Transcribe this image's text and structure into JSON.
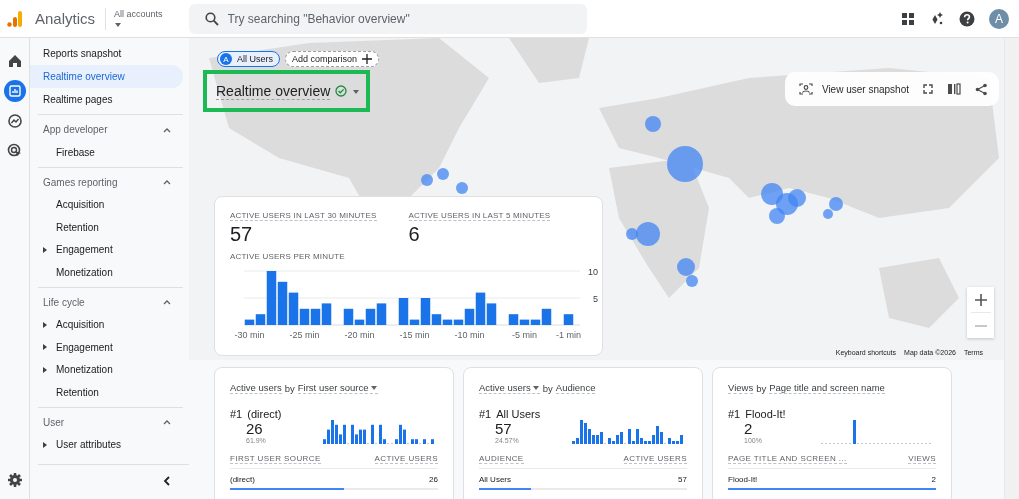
{
  "header": {
    "product": "Analytics",
    "account_label": "All accounts",
    "search": {
      "placeholder": "Try searching \"Behavior overview\""
    },
    "avatar": "A"
  },
  "rail": [
    {
      "kind": "home",
      "selected": false
    },
    {
      "kind": "reports",
      "selected": true
    },
    {
      "kind": "explore",
      "selected": false
    },
    {
      "kind": "advertising",
      "selected": false
    }
  ],
  "nav": {
    "top_items": [
      {
        "label": "Reports snapshot",
        "selected": false
      },
      {
        "label": "Realtime overview",
        "selected": true
      },
      {
        "label": "Realtime pages",
        "selected": false
      }
    ],
    "sections": [
      {
        "title": "App developer",
        "expanded": true,
        "items": [
          {
            "label": "Firebase",
            "has_children": false
          }
        ]
      },
      {
        "title": "Games reporting",
        "expanded": true,
        "items": [
          {
            "label": "Acquisition",
            "has_children": false
          },
          {
            "label": "Retention",
            "has_children": false
          },
          {
            "label": "Engagement",
            "has_children": true
          },
          {
            "label": "Monetization",
            "has_children": false
          }
        ]
      },
      {
        "title": "Life cycle",
        "expanded": true,
        "items": [
          {
            "label": "Acquisition",
            "has_children": true
          },
          {
            "label": "Engagement",
            "has_children": true
          },
          {
            "label": "Monetization",
            "has_children": true
          },
          {
            "label": "Retention",
            "has_children": false
          }
        ]
      },
      {
        "title": "User",
        "expanded": true,
        "items": [
          {
            "label": "User attributes",
            "has_children": true
          }
        ]
      }
    ]
  },
  "comparison": {
    "chips": [
      {
        "kind": "segment",
        "badge": "A",
        "label": "All Users"
      },
      {
        "kind": "add",
        "label": "Add comparison"
      }
    ]
  },
  "page_title": {
    "text": "Realtime overview",
    "highlighted": true
  },
  "toolbar": {
    "label": "View user snapshot"
  },
  "map": {
    "attribution": [
      "Keyboard shortcuts",
      "Map data ©2026",
      "Terms"
    ]
  },
  "summary": {
    "metrics": [
      {
        "label": "ACTIVE USERS IN LAST 30 MINUTES",
        "value": "57"
      },
      {
        "label": "ACTIVE USERS IN LAST 5 MINUTES",
        "value": "6"
      }
    ],
    "chart_title": "ACTIVE USERS PER MINUTE",
    "chart_data": {
      "type": "bar",
      "x": [
        -30,
        -29,
        -28,
        -27,
        -26,
        -25,
        -24,
        -23,
        -22,
        -21,
        -20,
        -19,
        -18,
        -17,
        -16,
        -15,
        -14,
        -13,
        -12,
        -11,
        -10,
        -9,
        -8,
        -7,
        -6,
        -5,
        -4,
        -3,
        -2,
        -1
      ],
      "values": [
        1,
        2,
        10,
        8,
        6,
        3,
        3,
        4,
        0,
        3,
        1,
        3,
        4,
        0,
        5,
        1,
        5,
        2,
        1,
        1,
        3,
        6,
        4,
        0,
        2,
        1,
        1,
        3,
        0,
        2
      ],
      "xlim": [
        -30.5,
        -0.5
      ],
      "ylim": [
        0,
        10
      ],
      "yticks": [
        5,
        10
      ],
      "xticks": [
        {
          "value": -30,
          "label": "-30 min"
        },
        {
          "value": -25,
          "label": "-25 min"
        },
        {
          "value": -20,
          "label": "-20 min"
        },
        {
          "value": -15,
          "label": "-15 min"
        },
        {
          "value": -10,
          "label": "-10 min"
        },
        {
          "value": -5,
          "label": "-5 min"
        },
        {
          "value": -1,
          "label": "-1 min"
        }
      ]
    }
  },
  "cards": [
    {
      "metric": "Active users",
      "metric_dropdown": false,
      "joiner": "by",
      "dimension": "First user source",
      "dimension_dropdown": true,
      "rank": "#1",
      "top_name": "(direct)",
      "top_value": "26",
      "top_share": "61.9%",
      "columns": [
        "FIRST USER SOURCE",
        "ACTIVE USERS"
      ],
      "rows": [
        {
          "label": "(direct)",
          "value": "26",
          "level": 0.55
        }
      ]
    },
    {
      "metric": "Active users",
      "metric_dropdown": true,
      "joiner": "by",
      "dimension": "Audience",
      "dimension_dropdown": false,
      "rank": "#1",
      "top_name": "All Users",
      "top_value": "57",
      "top_share": "24.57%",
      "columns": [
        "AUDIENCE",
        "ACTIVE USERS"
      ],
      "rows": [
        {
          "label": "All Users",
          "value": "57",
          "level": 0.25
        }
      ]
    },
    {
      "metric": "Views",
      "metric_dropdown": false,
      "joiner": "by",
      "dimension": "Page title and screen name",
      "dimension_dropdown": false,
      "rank": "#1",
      "top_name": "Flood-It!",
      "top_value": "2",
      "top_share": "100%",
      "columns": [
        "PAGE TITLE AND SCREEN ...",
        "VIEWS"
      ],
      "rows": [
        {
          "label": "Flood-It!",
          "value": "2",
          "level": 1
        }
      ]
    }
  ]
}
